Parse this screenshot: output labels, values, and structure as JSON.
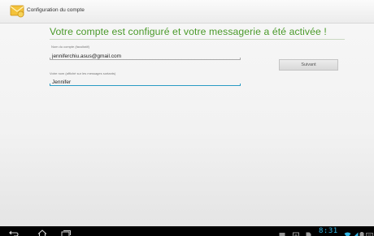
{
  "actionbar": {
    "title": "Configuration du compte",
    "icon": "account-setup-icon"
  },
  "main": {
    "headline": "Votre compte est configuré et votre messagerie a été activée !",
    "account_name": {
      "label": "Nom du compte (facultatif)",
      "value": "jenniferchiu.asus@gmail.com"
    },
    "your_name": {
      "label": "Votre nom (affiché sur les messages sortants)",
      "value": "Jennifer"
    },
    "next_label": "Suivant"
  },
  "navbar": {
    "back_icon": "back-icon",
    "home_icon": "home-icon",
    "recent_icon": "recent-apps-icon",
    "clock": "8:31"
  },
  "colors": {
    "headline": "#4a9a2a",
    "focus": "#2a9bc4",
    "clock": "#33b5e5",
    "navbar": "#000000"
  }
}
